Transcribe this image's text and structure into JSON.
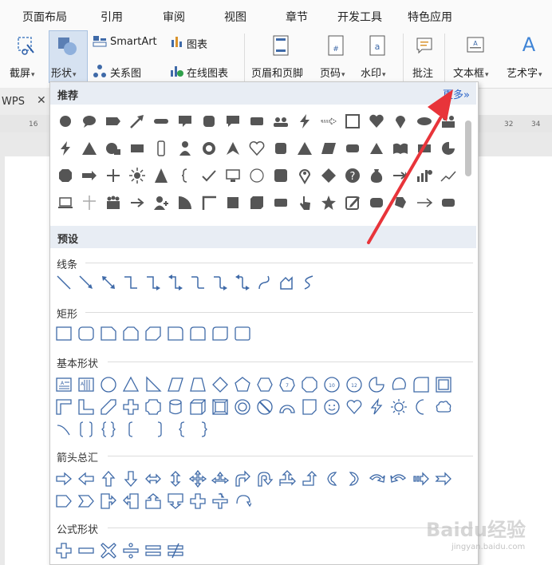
{
  "menu_tabs": [
    "页面布局",
    "引用",
    "审阅",
    "视图",
    "章节",
    "开发工具",
    "特色应用"
  ],
  "ribbon": {
    "screenshot": "截屏",
    "shapes": "形状",
    "smartart": "SmartArt",
    "chart": "图表",
    "relation": "关系图",
    "online_chart": "在线图表",
    "header_footer": "页眉和页脚",
    "page_number": "页码",
    "watermark": "水印",
    "comment": "批注",
    "textbox": "文本框",
    "wordart": "艺术字"
  },
  "doc_tab": "WPS",
  "ruler_ticks": [
    "16",
    "32",
    "34"
  ],
  "panel": {
    "recommended": "推荐",
    "more": "更多»",
    "presets": "预设",
    "groups": {
      "lines": "线条",
      "rect": "矩形",
      "basic": "基本形状",
      "arrows": "箭头总汇",
      "formula": "公式形状"
    },
    "octagon_number": "7",
    "decagon_number": "10",
    "dodecagon_number": "12"
  },
  "watermark": {
    "brand": "Baidu经验",
    "url": "jingyan.baidu.com"
  },
  "colors": {
    "accent": "#2a64c8",
    "arrow": "#e8343a",
    "shape_fill": "#555555",
    "preset_stroke": "#3f6aa8",
    "header_bg": "#e8edf4"
  }
}
